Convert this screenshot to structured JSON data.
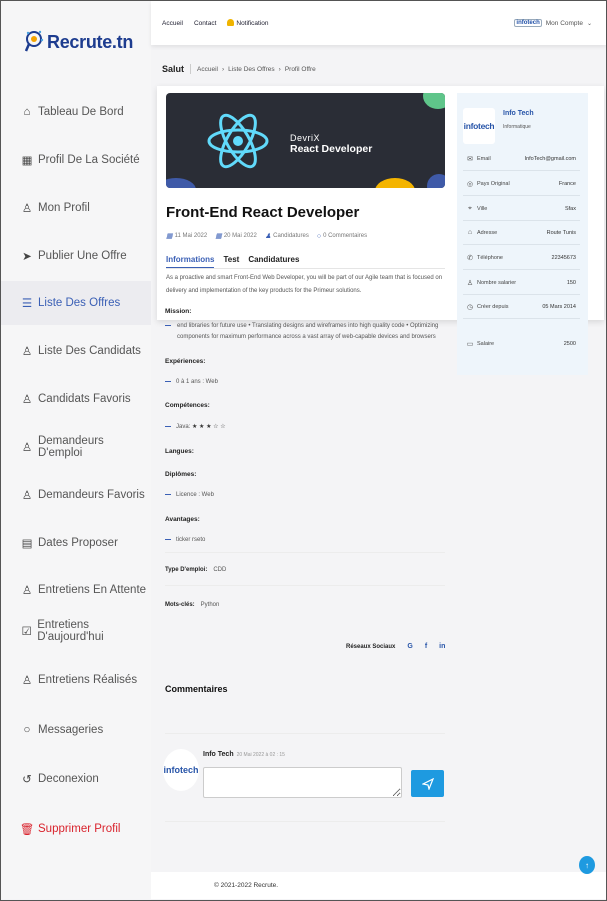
{
  "brand": {
    "name": "Recrute.tn"
  },
  "topbar": {
    "links": [
      "Accueil",
      "Contact",
      "Notification"
    ],
    "account_label": "Mon Compte",
    "account_logo": "infotech"
  },
  "sidebar": {
    "items": [
      {
        "label": "Tableau De Bord",
        "icon": "home-icon"
      },
      {
        "label": "Profil De La Société",
        "icon": "building-icon"
      },
      {
        "label": "Mon Profil",
        "icon": "user-icon"
      },
      {
        "label": "Publier Une Offre",
        "icon": "send-icon"
      },
      {
        "label": "Liste Des Offres",
        "icon": "list-icon"
      },
      {
        "label": "Liste Des Candidats",
        "icon": "users-list-icon"
      },
      {
        "label": "Candidats Favoris",
        "icon": "user-heart-icon"
      },
      {
        "label": "Demandeurs D'emploi",
        "icon": "user-search-icon"
      },
      {
        "label": "Demandeurs Favoris",
        "icon": "user-heart-icon"
      },
      {
        "label": "Dates Proposer",
        "icon": "calendar-icon"
      },
      {
        "label": "Entretiens En Attente",
        "icon": "users-clock-icon"
      },
      {
        "label": "Entretiens D'aujourd'hui",
        "icon": "calendar-check-icon"
      },
      {
        "label": "Entretiens Réalisés",
        "icon": "user-check-icon"
      },
      {
        "label": "Messageries",
        "icon": "chat-icon"
      },
      {
        "label": "Deconexion",
        "icon": "logout-icon"
      },
      {
        "label": "Supprimer Profil",
        "icon": "trash-icon"
      }
    ],
    "active_index": 4
  },
  "breadcrumb": {
    "greeting": "Salut",
    "items": [
      "Accueil",
      "Liste Des Offres",
      "Profil Offre"
    ]
  },
  "banner": {
    "line1": "DevriX",
    "line2": "React Developer"
  },
  "job": {
    "title": "Front-End React Developer",
    "date1": "11 Mai 2022",
    "date2": "20 Mai 2022",
    "candidatures": "Candidatures",
    "comments": "0 Commentaires",
    "tabs": [
      "Informations",
      "Test",
      "Candidatures"
    ],
    "intro": "As a proactive and smart Front-End Web Developer, you will be part of our Agile team that is focused on delivery and implementation of the key products for the Primeur solutions.",
    "mission_label": "Mission:",
    "mission_text": "end libraries for future use • Translating designs and wireframes into high quality code • Optimizing components for maximum performance across a vast array of web-capable devices and browsers",
    "experiences_label": "Expériences:",
    "experiences": "0 à 1 ans : Web",
    "competences_label": "Compétences:",
    "competences": "Java:",
    "competences_stars": "★ ★ ★ ☆ ☆",
    "langues_label": "Langues:",
    "diplomes_label": "Diplômes:",
    "diplomes": "Licence : Web",
    "avantages_label": "Avantages:",
    "avantages": "ticker rseto",
    "type_label": "Type D'emploi:",
    "type_value": "CDD",
    "keywords_label": "Mots-clés:",
    "keywords_value": "Python"
  },
  "company": {
    "logo": "infotech",
    "name": "Info Tech",
    "sector": "Informatique",
    "rows": [
      {
        "icon": "envelope-icon",
        "label": "Email",
        "value": "InfoTech@gmail.com"
      },
      {
        "icon": "globe-icon",
        "label": "Pays Original",
        "value": "France"
      },
      {
        "icon": "map-pin-icon",
        "label": "Ville",
        "value": "Sfax"
      },
      {
        "icon": "address-icon",
        "label": "Adresse",
        "value": "Route Tunis"
      },
      {
        "icon": "phone-icon",
        "label": "Téléphone",
        "value": "22345673"
      },
      {
        "icon": "users-icon",
        "label": "Nombre salarier",
        "value": "150"
      },
      {
        "icon": "clock-icon",
        "label": "Créer depuis",
        "value": "05 Mars 2014"
      },
      {
        "icon": "money-icon",
        "label": "Salaire",
        "value": "2500"
      }
    ]
  },
  "socials": {
    "label": "Réseaux Sociaux",
    "items": [
      "G",
      "f",
      "in"
    ]
  },
  "comments": {
    "title": "Commentaires",
    "author": "Info Tech",
    "date": "20 Mai 2022 à 02 : 15",
    "avatar": "infotech"
  },
  "footer": {
    "text": "© 2021-2022 Recrute."
  },
  "colors": {
    "accent": "#3a5fb5",
    "danger": "#d9232d",
    "button": "#1e9ae0"
  }
}
